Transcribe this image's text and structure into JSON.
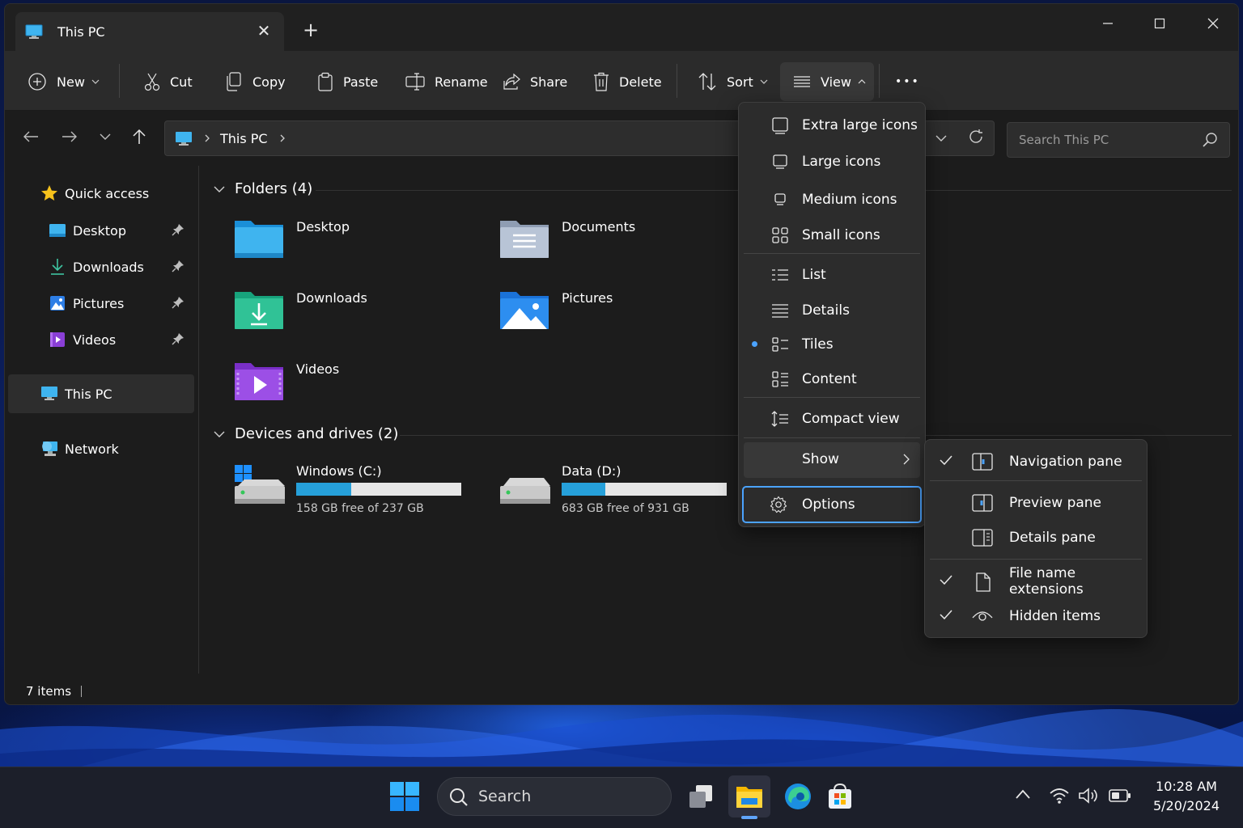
{
  "window": {
    "tab_title": "This PC",
    "tab_close_glyph": "✕",
    "new_tab_glyph": "+"
  },
  "commandbar": {
    "new": "New",
    "cut": "Cut",
    "copy": "Copy",
    "paste": "Paste",
    "rename": "Rename",
    "share": "Share",
    "delete": "Delete",
    "sort": "Sort",
    "view": "View",
    "more": "•••"
  },
  "address": {
    "location": "This PC",
    "search_placeholder": "Search This PC"
  },
  "sidebar": {
    "quick_access": "Quick access",
    "items": [
      {
        "label": "Desktop",
        "icon": "desktop-icon",
        "pinned": true
      },
      {
        "label": "Downloads",
        "icon": "downloads-icon",
        "pinned": true
      },
      {
        "label": "Pictures",
        "icon": "pictures-icon",
        "pinned": true
      },
      {
        "label": "Videos",
        "icon": "videos-icon",
        "pinned": true
      }
    ],
    "this_pc": "This PC",
    "network": "Network"
  },
  "content": {
    "folders_header": "Folders (4)",
    "folders": [
      {
        "name": "Desktop"
      },
      {
        "name": "Documents"
      },
      {
        "name": "Downloads"
      },
      {
        "name": "Pictures"
      },
      {
        "name": "Videos"
      }
    ],
    "drives_header": "Devices and drives (2)",
    "drives": [
      {
        "name": "Windows (C:)",
        "free_text": "158 GB free of 237 GB",
        "used_fraction": 0.333
      },
      {
        "name": "Data (D:)",
        "free_text": "683 GB free of 931 GB",
        "used_fraction": 0.266
      }
    ]
  },
  "status": {
    "items_count": "7 items"
  },
  "view_menu": {
    "items": [
      {
        "label": "Extra large icons"
      },
      {
        "label": "Large icons"
      },
      {
        "label": "Medium icons"
      },
      {
        "label": "Small icons"
      },
      {
        "label": "List"
      },
      {
        "label": "Details"
      },
      {
        "label": "Tiles",
        "selected": true
      },
      {
        "label": "Content"
      },
      {
        "label": "Compact view"
      },
      {
        "label": "Show"
      },
      {
        "label": "Options"
      }
    ]
  },
  "show_menu": {
    "items": [
      {
        "label": "Navigation pane",
        "checked": true
      },
      {
        "label": "Preview pane",
        "checked": false
      },
      {
        "label": "Details pane",
        "checked": false
      },
      {
        "label": "File name extensions",
        "checked": true
      },
      {
        "label": "Hidden items",
        "checked": true
      }
    ]
  },
  "taskbar": {
    "search_label": "Search",
    "time": "10:28 AM",
    "date": "5/20/2024"
  },
  "colors": {
    "accent": "#4ba3ff",
    "drive_fill": "#26a0da",
    "window_bg": "#1c1c1c",
    "menu_bg": "#2c2c2c"
  }
}
